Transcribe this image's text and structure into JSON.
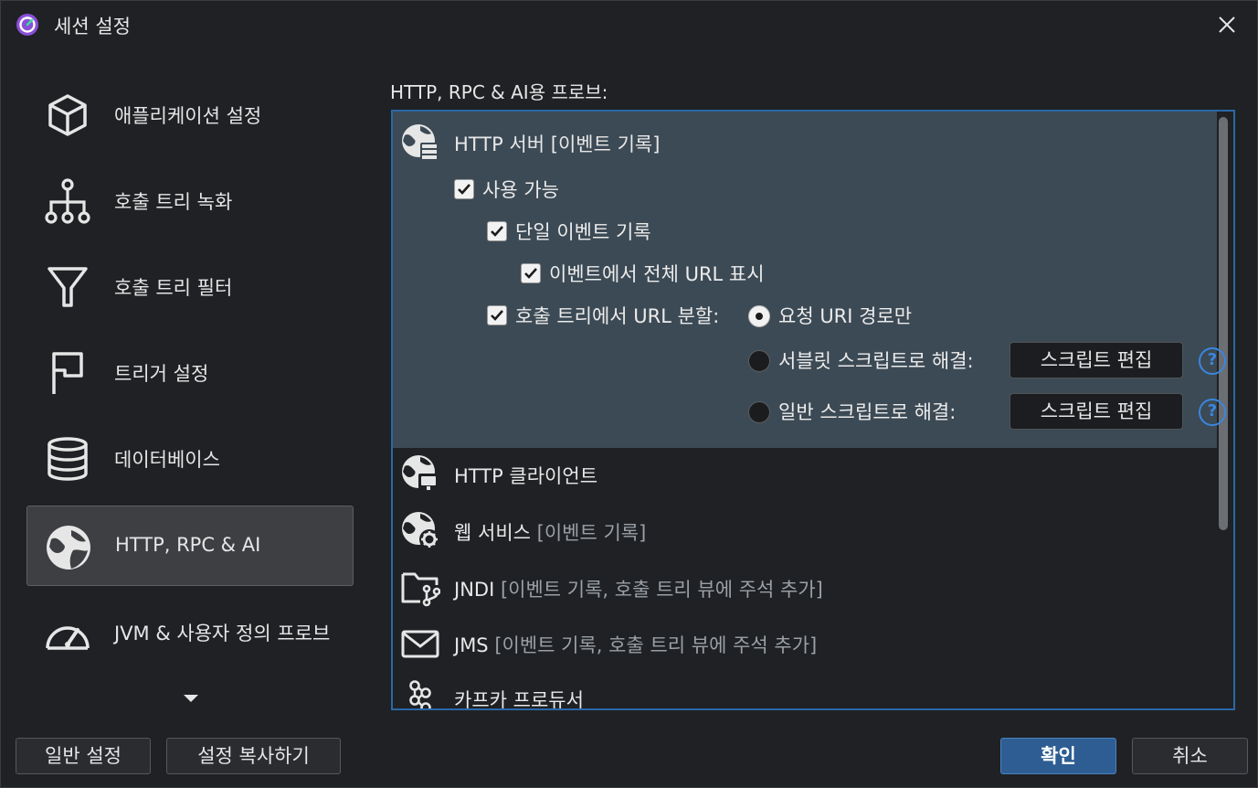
{
  "window": {
    "title": "세션 설정"
  },
  "sidebar": {
    "items": [
      {
        "label": "애플리케이션 설정",
        "icon": "cube-icon"
      },
      {
        "label": "호출 트리 녹화",
        "icon": "tree-icon"
      },
      {
        "label": "호출 트리 필터",
        "icon": "filter-icon"
      },
      {
        "label": "트리거 설정",
        "icon": "flag-icon"
      },
      {
        "label": "데이터베이스",
        "icon": "database-icon"
      },
      {
        "label": "HTTP, RPC & AI",
        "icon": "globe-icon",
        "selected": true
      },
      {
        "label": "JVM & 사용자 정의 프로브",
        "icon": "gauge-icon"
      }
    ]
  },
  "main": {
    "section_label": "HTTP, RPC & AI용 프로브:",
    "probes": [
      {
        "title": "HTTP 서버",
        "note": "[이벤트 기록]",
        "icon": "globe-server-icon",
        "expanded": true
      },
      {
        "title": "HTTP 클라이언트",
        "note": "",
        "icon": "globe-client-icon"
      },
      {
        "title": "웹 서비스",
        "note": "[이벤트 기록]",
        "icon": "globe-gear-icon"
      },
      {
        "title": "JNDI",
        "note": "[이벤트 기록, 호출 트리 뷰에 주석 추가]",
        "icon": "folder-branch-icon"
      },
      {
        "title": "JMS",
        "note": "[이벤트 기록, 호출 트리 뷰에 주석 추가]",
        "icon": "envelope-icon"
      },
      {
        "title": "카프카 프로듀서",
        "note": "",
        "icon": "kafka-icon"
      }
    ],
    "http_server_options": {
      "enabled": {
        "label": "사용 가능",
        "checked": true
      },
      "single_event": {
        "label": "단일 이벤트 기록",
        "checked": true
      },
      "full_url": {
        "label": "이벤트에서 전체 URL 표시",
        "checked": true
      },
      "split_url": {
        "label": "호출 트리에서 URL 분할:",
        "checked": true
      },
      "radio_request_uri": {
        "label": "요청 URI 경로만",
        "checked": true
      },
      "radio_servlet_script": {
        "label": "서블릿 스크립트로 해결:",
        "checked": false
      },
      "radio_general_script": {
        "label": "일반 스크립트로 해결:",
        "checked": false
      },
      "edit_script_label": "스크립트 편집",
      "help_glyph": "?"
    }
  },
  "footer": {
    "general_settings": "일반 설정",
    "copy_settings": "설정 복사하기",
    "ok": "확인",
    "cancel": "취소"
  },
  "colors": {
    "accent": "#2b67a8",
    "expanded_bg": "#3c4a55",
    "primary_button": "#2d5d92",
    "note_text": "#9aa0a6"
  }
}
